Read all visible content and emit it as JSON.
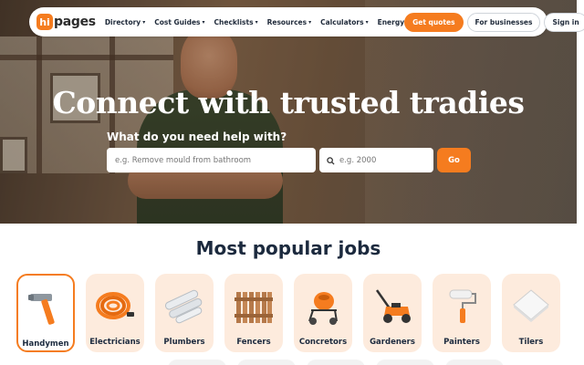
{
  "logo": {
    "badge": "hi",
    "text": "pages"
  },
  "nav": {
    "links": [
      {
        "label": "Directory",
        "has_caret": true
      },
      {
        "label": "Cost Guides",
        "has_caret": true
      },
      {
        "label": "Checklists",
        "has_caret": true
      },
      {
        "label": "Resources",
        "has_caret": true
      },
      {
        "label": "Calculators",
        "has_caret": true
      },
      {
        "label": "Energy",
        "has_caret": false
      }
    ],
    "caret": "▾",
    "get_quotes": "Get quotes",
    "for_businesses": "For businesses",
    "sign_in": "Sign in"
  },
  "hero": {
    "title": "Connect with trusted tradies",
    "search_label": "What do you need help with?",
    "job_placeholder": "e.g. Remove mould from bathroom",
    "postcode_placeholder": "e.g. 2000",
    "go_label": "Go"
  },
  "popular": {
    "title": "Most popular jobs",
    "jobs": [
      {
        "label": "Handymen",
        "icon": "hammer-icon",
        "active": true
      },
      {
        "label": "Electricians",
        "icon": "cable-coil-icon",
        "active": false
      },
      {
        "label": "Plumbers",
        "icon": "pipes-icon",
        "active": false
      },
      {
        "label": "Fencers",
        "icon": "fence-icon",
        "active": false
      },
      {
        "label": "Concretors",
        "icon": "cement-mixer-icon",
        "active": false
      },
      {
        "label": "Gardeners",
        "icon": "lawn-mower-icon",
        "active": false
      },
      {
        "label": "Painters",
        "icon": "paint-roller-icon",
        "active": false
      },
      {
        "label": "Tilers",
        "icon": "tile-icon",
        "active": false
      }
    ]
  },
  "colors": {
    "brand": "#f57c1f",
    "navy": "#1c2a3e",
    "card_bg": "#fdebdd"
  }
}
